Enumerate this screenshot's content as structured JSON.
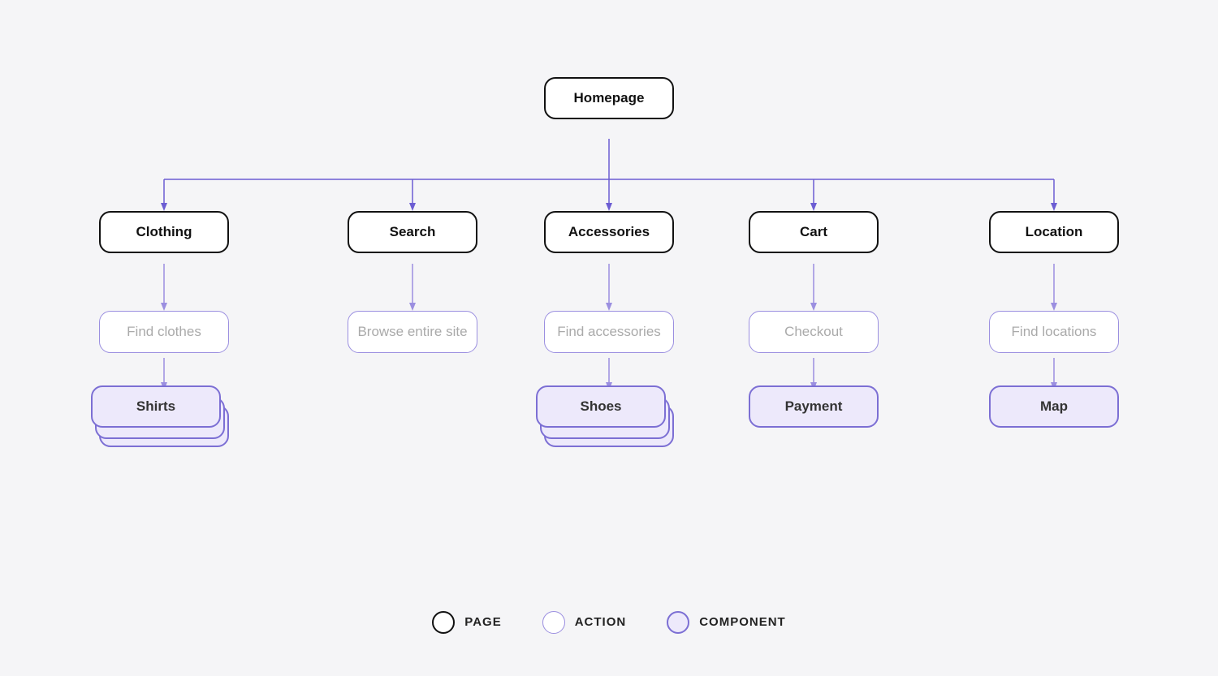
{
  "nodes": {
    "homepage": {
      "label": "Homepage"
    },
    "clothing": {
      "label": "Clothing"
    },
    "search": {
      "label": "Search"
    },
    "accessories": {
      "label": "Accessories"
    },
    "cart": {
      "label": "Cart"
    },
    "location": {
      "label": "Location"
    },
    "find_clothes": {
      "label": "Find clothes"
    },
    "browse_entire_site": {
      "label": "Browse entire site"
    },
    "find_accessories": {
      "label": "Find accessories"
    },
    "checkout": {
      "label": "Checkout"
    },
    "find_locations": {
      "label": "Find locations"
    },
    "shirts": {
      "label": "Shirts"
    },
    "shoes": {
      "label": "Shoes"
    },
    "payment": {
      "label": "Payment"
    },
    "map": {
      "label": "Map"
    }
  },
  "legend": {
    "page_label": "PAGE",
    "action_label": "ACTION",
    "component_label": "COMPONENT"
  },
  "colors": {
    "purple": "#6c5dd3",
    "purple_light": "#9b8fe0",
    "purple_fill": "#ede9fb",
    "black": "#111"
  }
}
